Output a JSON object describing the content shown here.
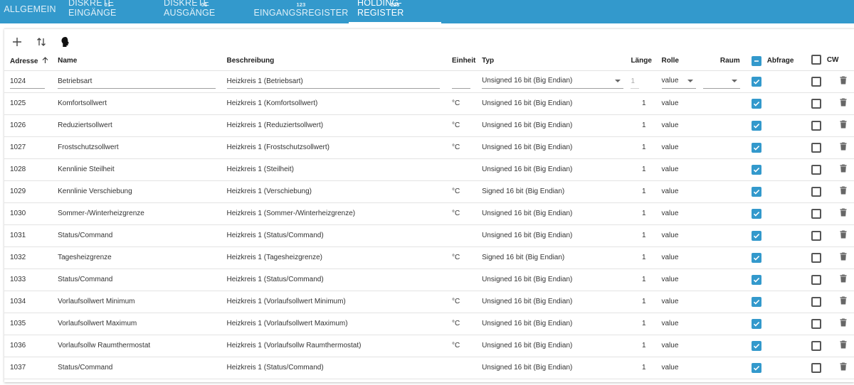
{
  "tabs": [
    {
      "label": "ALLGEMEIN",
      "sup": ""
    },
    {
      "label": "DISKRETE EINGÄNGE",
      "sup": "01"
    },
    {
      "label": "DISKRETE AUSGÄNGE",
      "sup": "01"
    },
    {
      "label": "EINGANGSREGISTER",
      "sup": "123"
    },
    {
      "label": "HOLDING-REGISTER",
      "sup": "123"
    }
  ],
  "active_tab": 4,
  "toolbar": {
    "icons": [
      "plus-icon",
      "sort-arrows-icon",
      "head-profile-icon"
    ]
  },
  "columns": {
    "address": "Adresse",
    "name": "Name",
    "description": "Beschreibung",
    "unit": "Einheit",
    "type": "Typ",
    "length": "Länge",
    "role": "Rolle",
    "room": "Raum",
    "poll": "Abfrage",
    "cw": "CW"
  },
  "rows": [
    {
      "address": "1024",
      "name": "Betriebsart",
      "description": "Heizkreis 1 (Betriebsart)",
      "unit": "",
      "type": "Unsigned 16 bit (Big Endian)",
      "length": "1",
      "role": "value",
      "poll": true,
      "cw": false
    },
    {
      "address": "1025",
      "name": "Komfortsollwert",
      "description": "Heizkreis 1 (Komfortsollwert)",
      "unit": "°C",
      "type": "Unsigned 16 bit (Big Endian)",
      "length": "1",
      "role": "value",
      "poll": true,
      "cw": false
    },
    {
      "address": "1026",
      "name": "Reduziertsollwert",
      "description": "Heizkreis 1 (Reduziertsollwert)",
      "unit": "°C",
      "type": "Unsigned 16 bit (Big Endian)",
      "length": "1",
      "role": "value",
      "poll": true,
      "cw": false
    },
    {
      "address": "1027",
      "name": "Frostschutzsollwert",
      "description": "Heizkreis 1 (Frostschutzsollwert)",
      "unit": "°C",
      "type": "Unsigned 16 bit (Big Endian)",
      "length": "1",
      "role": "value",
      "poll": true,
      "cw": false
    },
    {
      "address": "1028",
      "name": "Kennlinie Steilheit",
      "description": "Heizkreis 1 (Steilheit)",
      "unit": "",
      "type": "Unsigned 16 bit (Big Endian)",
      "length": "1",
      "role": "value",
      "poll": true,
      "cw": false
    },
    {
      "address": "1029",
      "name": "Kennlinie Verschiebung",
      "description": "Heizkreis 1 (Verschiebung)",
      "unit": "°C",
      "type": "Signed 16 bit (Big Endian)",
      "length": "1",
      "role": "value",
      "poll": true,
      "cw": false
    },
    {
      "address": "1030",
      "name": "Sommer-/Winterheizgrenze",
      "description": "Heizkreis 1 (Sommer-/Winterheizgrenze)",
      "unit": "°C",
      "type": "Unsigned 16 bit (Big Endian)",
      "length": "1",
      "role": "value",
      "poll": true,
      "cw": false
    },
    {
      "address": "1031",
      "name": "Status/Command",
      "description": "Heizkreis 1 (Status/Command)",
      "unit": "",
      "type": "Unsigned 16 bit (Big Endian)",
      "length": "1",
      "role": "value",
      "poll": true,
      "cw": false
    },
    {
      "address": "1032",
      "name": "Tagesheizgrenze",
      "description": "Heizkreis 1 (Tagesheizgrenze)",
      "unit": "°C",
      "type": "Signed 16 bit (Big Endian)",
      "length": "1",
      "role": "value",
      "poll": true,
      "cw": false
    },
    {
      "address": "1033",
      "name": "Status/Command",
      "description": "Heizkreis 1 (Status/Command)",
      "unit": "",
      "type": "Unsigned 16 bit (Big Endian)",
      "length": "1",
      "role": "value",
      "poll": true,
      "cw": false
    },
    {
      "address": "1034",
      "name": "Vorlaufsollwert Minimum",
      "description": "Heizkreis 1 (Vorlaufsollwert Minimum)",
      "unit": "°C",
      "type": "Unsigned 16 bit (Big Endian)",
      "length": "1",
      "role": "value",
      "poll": true,
      "cw": false
    },
    {
      "address": "1035",
      "name": "Vorlaufsollwert Maximum",
      "description": "Heizkreis 1 (Vorlaufsollwert Maximum)",
      "unit": "°C",
      "type": "Unsigned 16 bit (Big Endian)",
      "length": "1",
      "role": "value",
      "poll": true,
      "cw": false
    },
    {
      "address": "1036",
      "name": "Vorlaufsollw Raumthermostat",
      "description": "Heizkreis 1 (Vorlaufsollw Raumthermostat)",
      "unit": "°C",
      "type": "Unsigned 16 bit (Big Endian)",
      "length": "1",
      "role": "value",
      "poll": true,
      "cw": false
    },
    {
      "address": "1037",
      "name": "Status/Command",
      "description": "Heizkreis 1 (Status/Command)",
      "unit": "",
      "type": "Unsigned 16 bit (Big Endian)",
      "length": "1",
      "role": "value",
      "poll": true,
      "cw": false
    }
  ],
  "colors": {
    "accent": "#3399cc",
    "header_bar": "#3399cc"
  }
}
